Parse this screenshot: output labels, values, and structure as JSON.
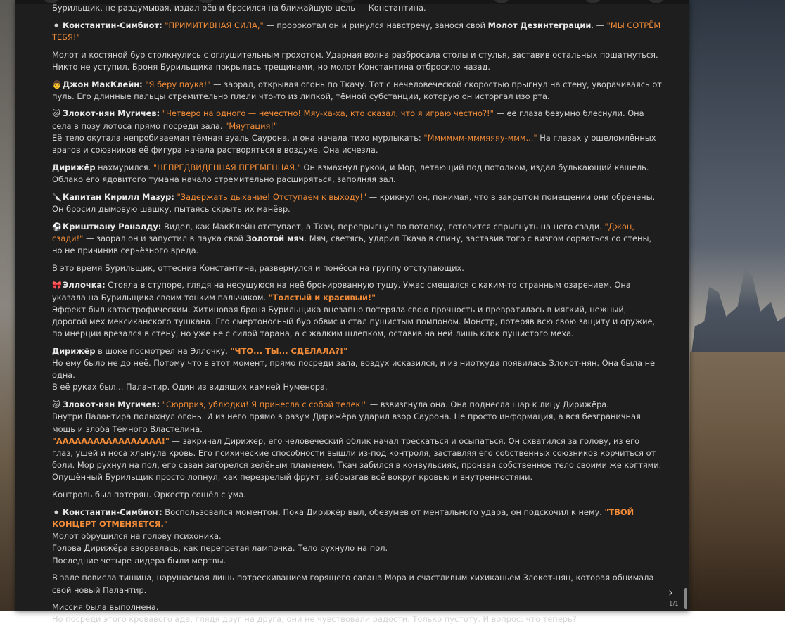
{
  "paragraphs": [
    {
      "lines": [
        {
          "segs": [
            {
              "t": "text",
              "v": "Бурильщик, не раздумывая, издал рёв и бросился на ближайшую цель — Константина."
            }
          ]
        }
      ]
    },
    {
      "lines": [
        {
          "segs": [
            {
              "t": "emoji",
              "v": "⚫"
            },
            {
              "t": "speaker",
              "v": "Константин-Симбиот:"
            },
            {
              "t": "text",
              "v": " "
            },
            {
              "t": "quote",
              "v": "\"ПРИМИТИВНАЯ СИЛА,\""
            },
            {
              "t": "text",
              "v": " — пророкотал он и ринулся навстречу, занося свой "
            },
            {
              "t": "bold",
              "v": "Молот Дезинтеграции"
            },
            {
              "t": "text",
              "v": ". — "
            },
            {
              "t": "quote",
              "v": "\"МЫ СОТРЁМ ТЕБЯ!\""
            }
          ]
        }
      ]
    },
    {
      "lines": [
        {
          "segs": [
            {
              "t": "text",
              "v": "Молот и костяной бур столкнулись с оглушительным грохотом. Ударная волна разбросала столы и стулья, заставив остальных пошатнуться. Никто не уступил. Броня Бурильщика покрылась трещинами, но молот Константина отбросило назад."
            }
          ]
        }
      ]
    },
    {
      "lines": [
        {
          "segs": [
            {
              "t": "emoji",
              "v": "👨"
            },
            {
              "t": "speaker",
              "v": "Джон МакКлейн:"
            },
            {
              "t": "text",
              "v": " "
            },
            {
              "t": "quote",
              "v": "\"Я беру паука!\""
            },
            {
              "t": "text",
              "v": " — заорал, открывая огонь по Ткачу. Тот с нечеловеческой скоростью прыгнул на стену, уворачиваясь от пуль. Его длинные пальцы стремительно плели что-то из липкой, тёмной субстанции, которую он исторгал изо рта."
            }
          ]
        }
      ]
    },
    {
      "lines": [
        {
          "segs": [
            {
              "t": "emoji",
              "v": "🐱"
            },
            {
              "t": "speaker",
              "v": "Злокот-нян Мугичев:"
            },
            {
              "t": "text",
              "v": " "
            },
            {
              "t": "quote",
              "v": "\"Четверо на одного — нечестно! Мяу-ха-ха, кто сказал, что я играю честно?!\""
            },
            {
              "t": "text",
              "v": " — её глаза безумно блеснули. Она села в позу лотоса прямо посреди зала. "
            },
            {
              "t": "quote",
              "v": "\"Мяутация!\""
            }
          ]
        },
        {
          "segs": [
            {
              "t": "text",
              "v": "Её тело окутала непробиваемая тёмная вуаль Саурона, и она начала тихо мурлыкать: "
            },
            {
              "t": "quote",
              "v": "\"Мммммм-мммяяяу-ммм...\""
            },
            {
              "t": "text",
              "v": " На глазах у ошеломлённых врагов и союзников её фигура начала растворяться в воздухе. Она исчезла."
            }
          ]
        }
      ]
    },
    {
      "lines": [
        {
          "segs": [
            {
              "t": "speaker",
              "v": "Дирижёр"
            },
            {
              "t": "text",
              "v": " нахмурился. "
            },
            {
              "t": "quote",
              "v": "\"НЕПРЕДВИДЕННАЯ ПЕРЕМЕННАЯ.\""
            },
            {
              "t": "text",
              "v": " Он взмахнул рукой, и Мор, летающий под потолком, издал булькающий кашель. Облако его ядовитого тумана начало стремительно расширяться, заполняя зал."
            }
          ]
        }
      ]
    },
    {
      "lines": [
        {
          "segs": [
            {
              "t": "emoji",
              "v": "🔪"
            },
            {
              "t": "speaker",
              "v": "Капитан Кирилл Мазур:"
            },
            {
              "t": "text",
              "v": " "
            },
            {
              "t": "quote",
              "v": "\"Задержать дыхание! Отступаем к выходу!\""
            },
            {
              "t": "text",
              "v": " — крикнул он, понимая, что в закрытом помещении они обречены. Он бросил дымовую шашку, пытаясь скрыть их манёвр."
            }
          ]
        }
      ]
    },
    {
      "lines": [
        {
          "segs": [
            {
              "t": "emoji",
              "v": "⚽"
            },
            {
              "t": "speaker",
              "v": "Криштиану Роналду:"
            },
            {
              "t": "text",
              "v": " Видел, как МакКлейн отступает, а Ткач, перепрыгнув по потолку, готовится спрыгнуть на него сзади. "
            },
            {
              "t": "quote",
              "v": "\"Джон, сзади!\""
            },
            {
              "t": "text",
              "v": " — заорал он и запустил в паука свой "
            },
            {
              "t": "bold",
              "v": "Золотой мяч"
            },
            {
              "t": "text",
              "v": ". Мяч, светясь, ударил Ткача в спину, заставив того с визгом сорваться со стены, но не причинив серьёзного вреда."
            }
          ]
        }
      ]
    },
    {
      "lines": [
        {
          "segs": [
            {
              "t": "text",
              "v": "В это время Бурильщик, оттеснив Константина, развернулся и понёсся на группу отступающих."
            }
          ]
        }
      ]
    },
    {
      "lines": [
        {
          "segs": [
            {
              "t": "emoji",
              "v": "🎀"
            },
            {
              "t": "speaker",
              "v": "Эллочка:"
            },
            {
              "t": "text",
              "v": " Стояла в ступоре, глядя на несущуюся на неё бронированную тушу. Ужас смешался с каким-то странным озарением. Она указала на Бурильщика своим тонким пальчиком. "
            },
            {
              "t": "quote-b",
              "v": "\"Толстый и красивый!\""
            }
          ]
        },
        {
          "segs": [
            {
              "t": "text",
              "v": "Эффект был катастрофическим. Хитиновая броня Бурильщика внезапно потеряла свою прочность и превратилась в мягкий, нежный, дорогой мех мексиканского тушканa. Его смертоносный бур обвис и стал пушистым помпоном. Монстр, потеряв всю свою защиту и оружие, по инерции врезался в стену, но уже не с силой тарана, а с жалким шлепком, оставив на ней лишь клок пушистого меха."
            }
          ]
        }
      ]
    },
    {
      "lines": [
        {
          "segs": [
            {
              "t": "speaker",
              "v": "Дирижёр"
            },
            {
              "t": "text",
              "v": " в шоке посмотрел на Эллочку. "
            },
            {
              "t": "quote-b",
              "v": "\"ЧТО... ТЫ... СДЕЛАЛА?!\""
            }
          ]
        },
        {
          "segs": [
            {
              "t": "text",
              "v": "Но ему было не до неё. Потому что в этот момент, прямо посреди зала, воздух исказился, и из ниоткуда появилась Злокот-нян. Она была не одна."
            }
          ]
        },
        {
          "segs": [
            {
              "t": "text",
              "v": "В её руках был... Палантир. Один из видящих камней Нуменора."
            }
          ]
        }
      ]
    },
    {
      "lines": [
        {
          "segs": [
            {
              "t": "emoji",
              "v": "🐱"
            },
            {
              "t": "speaker",
              "v": "Злокот-нян Мугичев:"
            },
            {
              "t": "text",
              "v": " "
            },
            {
              "t": "quote",
              "v": "\"Сюрприз, ублюдки! Я принесла с собой телек!\""
            },
            {
              "t": "text",
              "v": " — взвизгнула она. Она поднесла шар к лицу Дирижёра."
            }
          ]
        },
        {
          "segs": [
            {
              "t": "text",
              "v": "Внутри Палантира полыхнул огонь. И из него прямо в разум Дирижёра ударил взор Саурона. Не просто информация, а вся безграничная мощь и злоба Тёмного Властелина."
            }
          ]
        },
        {
          "segs": [
            {
              "t": "quote-b",
              "v": "\"ААААААААААААААААА!\""
            },
            {
              "t": "text",
              "v": " — закричал Дирижёр, его человеческий облик начал трескаться и осыпаться. Он схватился за голову, из его глаз, ушей и носа хлынула кровь. Его психические способности вышли из-под контроля, заставляя его собственных союзников корчиться от боли. Мор рухнул на пол, его саван загорелся зелёным пламенем. Ткач забился в конвульсиях, пронзая собственное тело своими же когтями. Опушённый Бурильщик просто лопнул, как перезрелый фрукт, забрызгав всё вокруг кровью и внутренностями."
            }
          ]
        }
      ]
    },
    {
      "lines": [
        {
          "segs": [
            {
              "t": "text",
              "v": "Контроль был потерян. Оркестр сошёл с ума."
            }
          ]
        }
      ]
    },
    {
      "lines": [
        {
          "segs": [
            {
              "t": "emoji",
              "v": "⚫"
            },
            {
              "t": "speaker",
              "v": "Константин-Симбиот:"
            },
            {
              "t": "text",
              "v": " Воспользовался моментом. Пока Дирижёр выл, обезумев от ментального удара, он подскочил к нему. "
            },
            {
              "t": "quote-b",
              "v": "\"ТВОЙ КОНЦЕРТ ОТМЕНЯЕТСЯ.\""
            }
          ]
        },
        {
          "segs": [
            {
              "t": "text",
              "v": "Молот обрушился на голову психоника."
            }
          ]
        },
        {
          "segs": [
            {
              "t": "text",
              "v": "Голова Дирижёра взорвалась, как перегретая лампочка. Тело рухнуло на пол."
            }
          ]
        },
        {
          "segs": [
            {
              "t": "text",
              "v": "Последние четыре лидера были мертвы."
            }
          ]
        }
      ]
    },
    {
      "lines": [
        {
          "segs": [
            {
              "t": "text",
              "v": "В зале повисла тишина, нарушаемая лишь потрескиванием горящего савана Мора и счастливым хихиканьем Злокот-нян, которая обнимала свой новый Палантир."
            }
          ]
        }
      ]
    },
    {
      "lines": [
        {
          "segs": [
            {
              "t": "text",
              "v": "Миссия была выполнена."
            }
          ]
        },
        {
          "segs": [
            {
              "t": "text",
              "v": "Но посреди этого кровавого ада, глядя друг на друга, они не чувствовали радости. Только пустоту. И вопрос: что теперь?"
            }
          ]
        }
      ]
    }
  ],
  "pager": {
    "label": "1/1",
    "next_icon": "›"
  }
}
